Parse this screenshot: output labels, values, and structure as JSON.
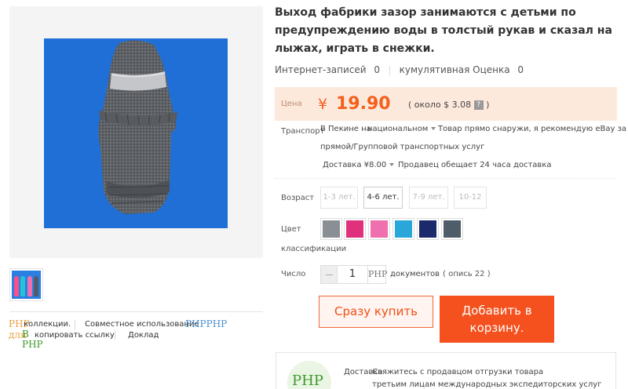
{
  "product": {
    "title": "Выход фабрики зазор занимаются с детьми по предупреждению воды в толстый рукав и сказал на лыжах, играть в снежки."
  },
  "stats": {
    "records_label": "Интернет-записей",
    "records_value": "0",
    "rating_label": "кумулятивная Оценка",
    "rating_value": "0"
  },
  "price": {
    "label": "Цена",
    "currency_symbol": "¥",
    "amount": "19.90",
    "converted": "( около $ 3.08",
    "help": "?",
    "converted_close": ")"
  },
  "shipping": {
    "label": "Транспорт",
    "from": "В Пекине на",
    "scope": "национальном",
    "note_line1": "Товар прямо снаружи, я рекомендую eBay за",
    "note_line2": "прямой/Групповой транспортных услуг",
    "delivery": "Доставка ¥8.00",
    "promise": "Продавец обещает 24 часа доставка"
  },
  "age": {
    "label": "Возраст",
    "options": [
      "1-3 лет.",
      "4-6 лет.",
      "7-9 лет.",
      "10-12"
    ],
    "selected": "4-6 лет."
  },
  "color": {
    "label_line1": "Цвет",
    "label_line2": "классификации",
    "swatches": [
      "#8a8f96",
      "#e0317d",
      "#f06fae",
      "#28a7d8",
      "#1a2a6b",
      "#4f5d6b"
    ]
  },
  "quantity": {
    "label": "Число",
    "value": "1",
    "unit": "документов",
    "stock": "( опись 22 )",
    "plus_icon_text": "PHP"
  },
  "actions": {
    "buy_now": "Сразу купить",
    "add_to_cart_line1": "Добавить в",
    "add_to_cart_line2": "корзину."
  },
  "share": {
    "php_a": "PHP",
    "collect": "коллекции.",
    "shared_use": "Совместное использование",
    "php_b": "PHPPHP",
    "for_label": "для",
    "in_label": "В",
    "copy_link": "копировать ссылку",
    "report": "Доклад",
    "php_c": "PHP"
  },
  "shop": {
    "logo_text": "PHP",
    "delivery_label": "Доставка",
    "contact": "Свяжитесь с продавцом отгрузки товара",
    "third_party": "третьим лицам международных экспедиторских услуг"
  },
  "colors": {
    "accent": "#f4511e",
    "price": "#f55f1b",
    "price_bg": "#fde9dc",
    "product_bg": "#1f6fd6"
  }
}
